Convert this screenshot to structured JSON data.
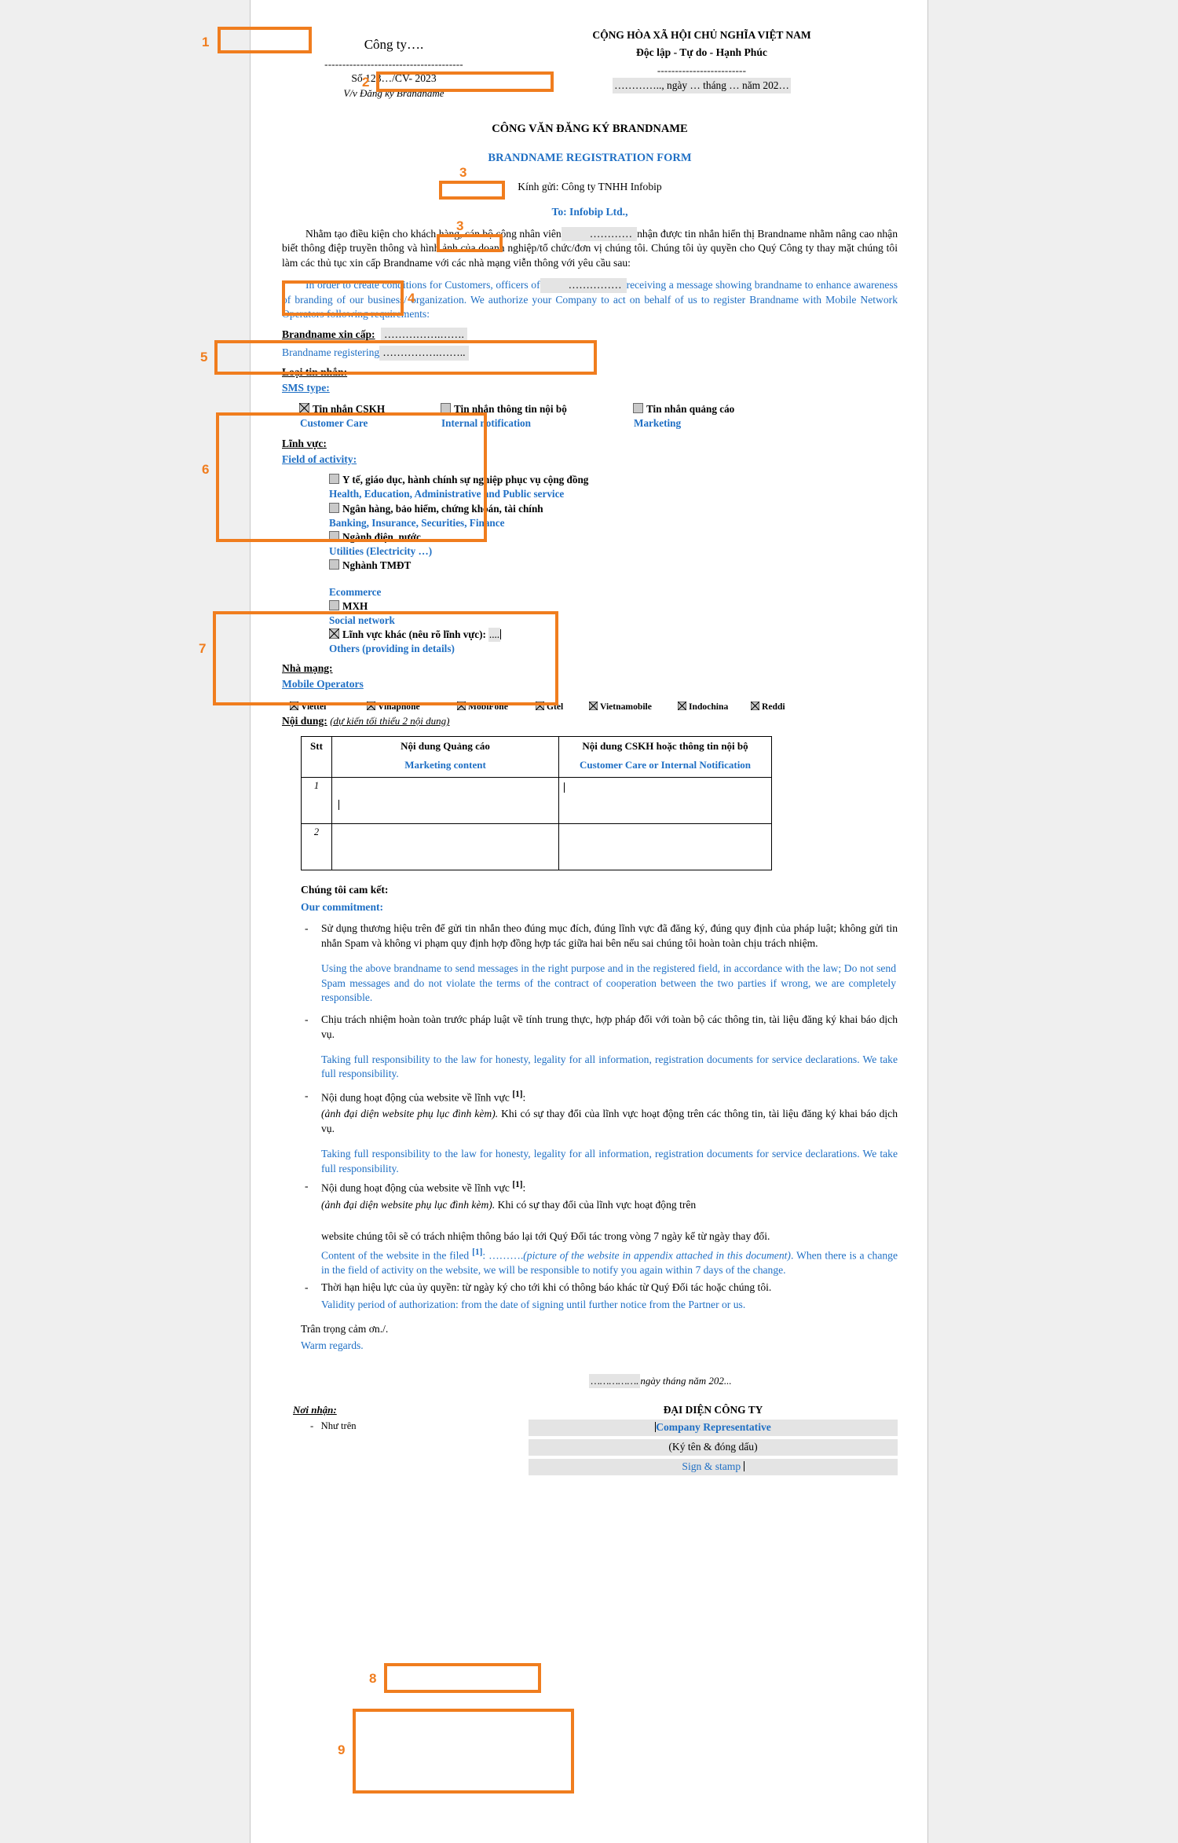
{
  "meta": {
    "accent_color": "#f07d1e",
    "english_color": "#1f6fc4",
    "page_bg": "#ffffff",
    "canvas_bg": "#efefef",
    "field_shade": "#e4e4e4"
  },
  "header": {
    "company_field": "Công ty….",
    "dashes_left": "---------------------------------------",
    "doc_number": "Số 123…/CV- 2023",
    "subject": "V/v Đăng ký Brandname",
    "national_line1": "CỘNG HÒA XÃ HỘI CHỦ NGHĨA VIỆT NAM",
    "national_line2": "Độc lập - Tự do - Hạnh Phúc",
    "dashes_right": "-------------------------",
    "date_field": "………….., ngày … tháng … năm 202…"
  },
  "titles": {
    "vn": "CÔNG VĂN ĐĂNG KÝ BRANDNAME",
    "en": "BRANDNAME REGISTRATION FORM",
    "recipient_vn": "Kính gửi: Công ty TNHH Infobip",
    "recipient_en": "To: Infobip Ltd.,"
  },
  "intro": {
    "vn_part1": "Nhằm tạo điều kiện cho khách hàng, cán bộ công nhân viên",
    "vn_blank": "…………",
    "vn_part2": "nhận được tin nhắn hiển thị Brandname nhằm nâng cao nhận biết thông điệp truyền thông và hình ảnh của doanh nghiệp/tổ chức/đơn vị chúng tôi. Chúng tôi ủy quyền cho Quý Công ty thay mặt chúng tôi làm các thủ tục xin cấp Brandname với các nhà mạng viễn thông với yêu cầu sau:",
    "en_part1": "In order to create conditions for Customers, officers of",
    "en_blank": "……………",
    "en_part2": "receiving a message showing brandname to enhance awareness of branding of our business/ organization. We authorize your Company to act on behalf of us to register Brandname with Mobile Network Operators following requirements:"
  },
  "brandname": {
    "label_vn": "Brandname xin cấp:",
    "label_en": "Brandname registering",
    "value_vn": "…………….…….",
    "value_en": "…………….…….."
  },
  "sms_type": {
    "label_vn": "Loại tin nhắn:",
    "label_en": "SMS type:",
    "options": [
      {
        "vn": "Tin nhắn CSKH",
        "en": "Customer Care",
        "checked": true
      },
      {
        "vn": "Tin nhắn thông tin nội bộ",
        "en": "Internal notification",
        "checked": false
      },
      {
        "vn": "Tin nhắn quảng cáo",
        "en": "Marketing",
        "checked": false
      }
    ]
  },
  "field_of_activity": {
    "label_vn": "Lĩnh vực:",
    "label_en": "Field of activity:",
    "options": [
      {
        "vn": "Y tế, giáo dục, hành chính sự nghiệp phục vụ cộng đồng",
        "en": "Health, Education, Administrative and Public service",
        "checked": false
      },
      {
        "vn": "Ngân hàng, bảo hiểm, chứng khoán, tài chính",
        "en": "Banking, Insurance, Securities, Finance",
        "checked": false
      },
      {
        "vn": "Ngành điện, nước",
        "en": "Utilities (Electricity …)",
        "checked": false
      },
      {
        "vn": "Nghành TMĐT",
        "en": "Ecommerce",
        "checked": false
      },
      {
        "vn": "MXH",
        "en": "Social network",
        "checked": false
      },
      {
        "vn": "Lĩnh vực khác (nêu rõ lĩnh vực):",
        "en": "Others (providing in details)",
        "checked": true,
        "inline_value": "...."
      }
    ]
  },
  "operators": {
    "label_vn": "Nhà mạng:",
    "label_en": "Mobile Operators",
    "items": [
      {
        "name": "Viettel",
        "checked": true
      },
      {
        "name": "Vinaphone",
        "checked": true
      },
      {
        "name": "MobiFone",
        "checked": true
      },
      {
        "name": "Gtel",
        "checked": true
      },
      {
        "name": "Vietnamobile",
        "checked": true
      },
      {
        "name": "Indochina",
        "checked": true
      },
      {
        "name": "Reddi",
        "checked": true
      }
    ]
  },
  "content_table": {
    "label_vn": "Nội dung:",
    "label_note": "(dự kiến tối thiểu 2 nội dung)",
    "headers": [
      {
        "vn": "Stt",
        "en": ""
      },
      {
        "vn": "Nội dung Quảng cáo",
        "en": "Marketing content"
      },
      {
        "vn": "Nội dung CSKH hoặc thông tin nội bộ",
        "en": "Customer Care or Internal Notification"
      }
    ],
    "rows": [
      {
        "stt": "1",
        "marketing": "",
        "care": ""
      },
      {
        "stt": "2",
        "marketing": "",
        "care": ""
      }
    ]
  },
  "commitment": {
    "label_vn": "Chúng tôi cam kết:",
    "label_en": "Our commitment:",
    "items": [
      {
        "vn": "Sử dụng thương hiệu trên để gửi tin nhắn theo đúng mục đích, đúng lĩnh vực đã đăng ký, đúng quy định của pháp luật; không gửi tin nhắn Spam và không vi phạm quy định hợp đồng hợp tác giữa hai bên nếu sai chúng tôi hoàn toàn chịu trách nhiệm.",
        "en": "Using the above brandname to send messages in the right purpose and in the registered field, in accordance with the law; Do not send Spam messages and do not violate the terms of the contract of cooperation between the two parties if wrong, we are completely responsible."
      },
      {
        "vn": "Chịu trách nhiệm hoàn toàn trước pháp luật về tính trung thực, hợp pháp đối với toàn bộ các thông tin, tài liệu đăng ký khai báo dịch vụ.",
        "en": "Taking full responsibility to the law for honesty, legality for all information, registration documents for service declarations. We take full responsibility."
      }
    ],
    "website_item_1": {
      "vn_head": "Nội dung hoạt động của website về lĩnh vực",
      "vn_sup": "[1]",
      "vn_colon": ":",
      "vn_italic": "(ảnh đại diện website phụ lục đình kèm).",
      "vn_rest": "Khi có sự thay đổi của lĩnh vực hoạt động trên các thông tin, tài liệu đăng ký khai báo dịch vụ.",
      "en": "Taking full responsibility to the law for honesty, legality for all information, registration documents for service declarations. We take full responsibility."
    },
    "website_item_2": {
      "vn_head": "Nội dung hoạt động của website về lĩnh vực",
      "vn_sup": "[1]",
      "vn_colon": ":",
      "vn_italic": "(ảnh đại diện website phụ lục đình kèm).",
      "vn_rest": "Khi có sự thay đổi của lĩnh vực hoạt động trên",
      "vn_rest2": "website chúng tôi sẽ có trách nhiệm thông báo lại tới Quý Đối tác trong vòng 7 ngày kể từ ngày thay đổi.",
      "en_head": "Content of the website in the filed",
      "en_sup": "[1]",
      "en_dots": ": ……….",
      "en_italic": "(picture of the website in appendix attached in this document)",
      "en_rest": ". When there is a change in the field of activity on the website, we will be responsible to notify you again within 7 days of the change."
    },
    "validity": {
      "vn": "Thời hạn hiệu lực của ủy quyền: từ ngày ký cho tới khi có thông báo khác từ Quý Đối tác hoặc chúng tôi.",
      "en": "Validity period of authorization: from the date of signing until further notice from the Partner or us."
    },
    "thanks_vn": "Trân trọng cảm ơn./.",
    "thanks_en": "Warm regards."
  },
  "signature": {
    "date_blank": "…………….",
    "date_rest": "ngày      tháng      năm 202...",
    "recipients_label": "Nơi nhận:",
    "recipients_item": "Như trên",
    "rep_vn": "ĐẠI DIỆN CÔNG TY",
    "rep_en": "Company Representative",
    "sign_vn": "(Ký tên & đóng dấu)",
    "sign_en": "Sign & stamp"
  },
  "annotations": [
    {
      "n": "1"
    },
    {
      "n": "2"
    },
    {
      "n": "3"
    },
    {
      "n": "3"
    },
    {
      "n": "4"
    },
    {
      "n": "5"
    },
    {
      "n": "6"
    },
    {
      "n": "7"
    },
    {
      "n": "8"
    },
    {
      "n": "9"
    }
  ]
}
